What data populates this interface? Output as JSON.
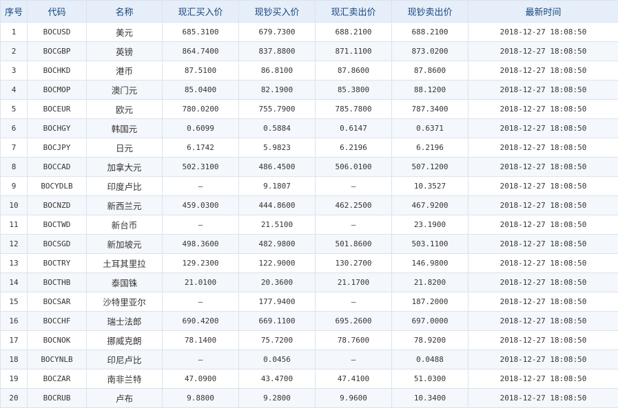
{
  "headers": [
    "序号",
    "代码",
    "名称",
    "现汇买入价",
    "现钞买入价",
    "现汇卖出价",
    "现钞卖出价",
    "最新时间"
  ],
  "rows": [
    {
      "no": "1",
      "code": "BOCUSD",
      "name": "美元",
      "spot_buy": "685.3100",
      "cash_buy": "679.7300",
      "spot_sell": "688.2100",
      "cash_sell": "688.2100",
      "time": "2018-12-27 18:08:50"
    },
    {
      "no": "2",
      "code": "BOCGBP",
      "name": "英镑",
      "spot_buy": "864.7400",
      "cash_buy": "837.8800",
      "spot_sell": "871.1100",
      "cash_sell": "873.0200",
      "time": "2018-12-27 18:08:50"
    },
    {
      "no": "3",
      "code": "BOCHKD",
      "name": "港币",
      "spot_buy": "87.5100",
      "cash_buy": "86.8100",
      "spot_sell": "87.8600",
      "cash_sell": "87.8600",
      "time": "2018-12-27 18:08:50"
    },
    {
      "no": "4",
      "code": "BOCMOP",
      "name": "澳门元",
      "spot_buy": "85.0400",
      "cash_buy": "82.1900",
      "spot_sell": "85.3800",
      "cash_sell": "88.1200",
      "time": "2018-12-27 18:08:50"
    },
    {
      "no": "5",
      "code": "BOCEUR",
      "name": "欧元",
      "spot_buy": "780.0200",
      "cash_buy": "755.7900",
      "spot_sell": "785.7800",
      "cash_sell": "787.3400",
      "time": "2018-12-27 18:08:50"
    },
    {
      "no": "6",
      "code": "BOCHGY",
      "name": "韩国元",
      "spot_buy": "0.6099",
      "cash_buy": "0.5884",
      "spot_sell": "0.6147",
      "cash_sell": "0.6371",
      "time": "2018-12-27 18:08:50"
    },
    {
      "no": "7",
      "code": "BOCJPY",
      "name": "日元",
      "spot_buy": "6.1742",
      "cash_buy": "5.9823",
      "spot_sell": "6.2196",
      "cash_sell": "6.2196",
      "time": "2018-12-27 18:08:50"
    },
    {
      "no": "8",
      "code": "BOCCAD",
      "name": "加拿大元",
      "spot_buy": "502.3100",
      "cash_buy": "486.4500",
      "spot_sell": "506.0100",
      "cash_sell": "507.1200",
      "time": "2018-12-27 18:08:50"
    },
    {
      "no": "9",
      "code": "BOCYDLB",
      "name": "印度卢比",
      "spot_buy": "–",
      "cash_buy": "9.1807",
      "spot_sell": "–",
      "cash_sell": "10.3527",
      "time": "2018-12-27 18:08:50"
    },
    {
      "no": "10",
      "code": "BOCNZD",
      "name": "新西兰元",
      "spot_buy": "459.0300",
      "cash_buy": "444.8600",
      "spot_sell": "462.2500",
      "cash_sell": "467.9200",
      "time": "2018-12-27 18:08:50"
    },
    {
      "no": "11",
      "code": "BOCTWD",
      "name": "新台币",
      "spot_buy": "–",
      "cash_buy": "21.5100",
      "spot_sell": "–",
      "cash_sell": "23.1900",
      "time": "2018-12-27 18:08:50"
    },
    {
      "no": "12",
      "code": "BOCSGD",
      "name": "新加坡元",
      "spot_buy": "498.3600",
      "cash_buy": "482.9800",
      "spot_sell": "501.8600",
      "cash_sell": "503.1100",
      "time": "2018-12-27 18:08:50"
    },
    {
      "no": "13",
      "code": "BOCTRY",
      "name": "土耳其里拉",
      "spot_buy": "129.2300",
      "cash_buy": "122.9000",
      "spot_sell": "130.2700",
      "cash_sell": "146.9800",
      "time": "2018-12-27 18:08:50"
    },
    {
      "no": "14",
      "code": "BOCTHB",
      "name": "泰国铢",
      "spot_buy": "21.0100",
      "cash_buy": "20.3600",
      "spot_sell": "21.1700",
      "cash_sell": "21.8200",
      "time": "2018-12-27 18:08:50"
    },
    {
      "no": "15",
      "code": "BOCSAR",
      "name": "沙特里亚尔",
      "spot_buy": "–",
      "cash_buy": "177.9400",
      "spot_sell": "–",
      "cash_sell": "187.2000",
      "time": "2018-12-27 18:08:50"
    },
    {
      "no": "16",
      "code": "BOCCHF",
      "name": "瑞士法郎",
      "spot_buy": "690.4200",
      "cash_buy": "669.1100",
      "spot_sell": "695.2600",
      "cash_sell": "697.0000",
      "time": "2018-12-27 18:08:50"
    },
    {
      "no": "17",
      "code": "BOCNOK",
      "name": "挪威克朗",
      "spot_buy": "78.1400",
      "cash_buy": "75.7200",
      "spot_sell": "78.7600",
      "cash_sell": "78.9200",
      "time": "2018-12-27 18:08:50"
    },
    {
      "no": "18",
      "code": "BOCYNLB",
      "name": "印尼卢比",
      "spot_buy": "–",
      "cash_buy": "0.0456",
      "spot_sell": "–",
      "cash_sell": "0.0488",
      "time": "2018-12-27 18:08:50"
    },
    {
      "no": "19",
      "code": "BOCZAR",
      "name": "南非兰特",
      "spot_buy": "47.0900",
      "cash_buy": "43.4700",
      "spot_sell": "47.4100",
      "cash_sell": "51.0300",
      "time": "2018-12-27 18:08:50"
    },
    {
      "no": "20",
      "code": "BOCRUB",
      "name": "卢布",
      "spot_buy": "9.8800",
      "cash_buy": "9.2800",
      "spot_sell": "9.9600",
      "cash_sell": "10.3400",
      "time": "2018-12-27 18:08:50"
    }
  ]
}
